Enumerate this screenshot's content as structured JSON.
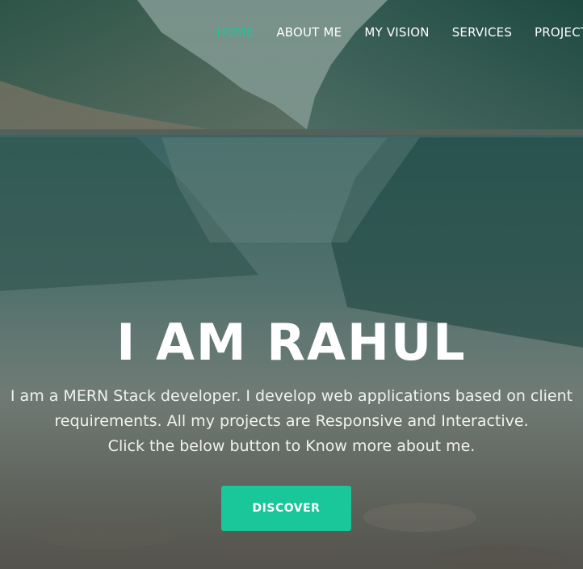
{
  "nav": {
    "items": [
      {
        "label": "HOME",
        "active": true
      },
      {
        "label": "ABOUT ME",
        "active": false
      },
      {
        "label": "MY VISION",
        "active": false
      },
      {
        "label": "SERVICES",
        "active": false
      },
      {
        "label": "PROJECTS",
        "active": false
      }
    ]
  },
  "hero": {
    "title": "I AM RAHUL",
    "intro_lines": [
      "I am a MERN Stack developer. I develop web applications based on client",
      "requirements. All my projects are Responsive and Interactive.",
      "Click the below button to Know more about me."
    ],
    "button_label": "DISCOVER"
  },
  "colors": {
    "accent": "#19c79a",
    "text": "#ffffff"
  }
}
